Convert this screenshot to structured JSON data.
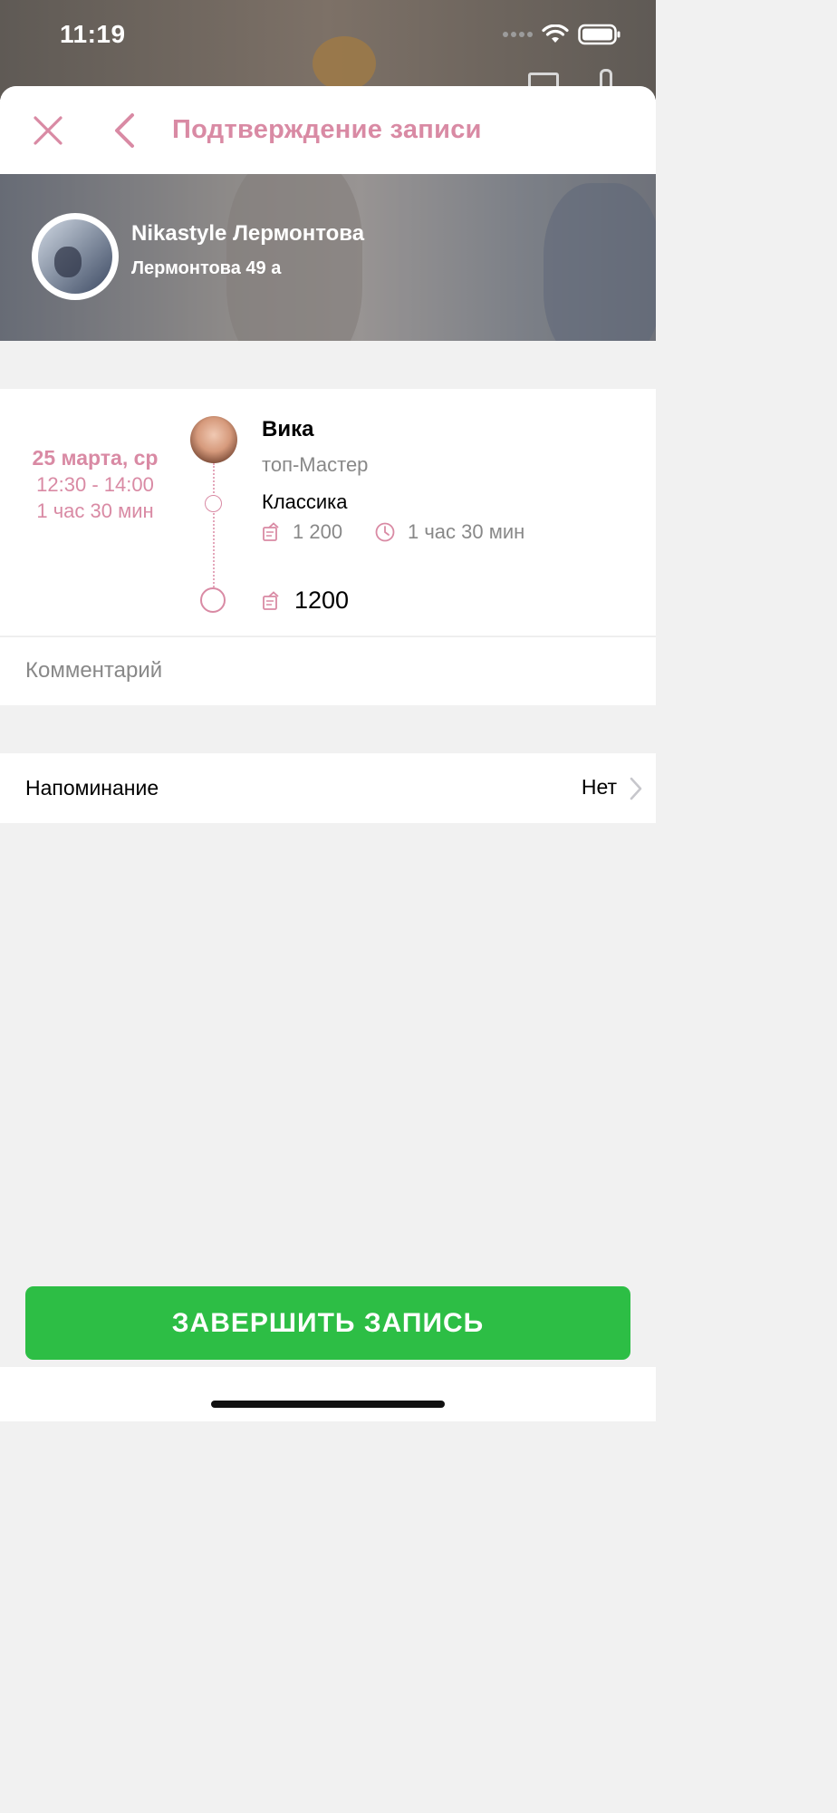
{
  "status_bar": {
    "time": "11:19"
  },
  "header": {
    "title": "Подтверждение записи"
  },
  "salon": {
    "name": "Nikastyle Лермонтова",
    "address": "Лермонтова 49 а"
  },
  "appointment": {
    "date": "25 марта, ср",
    "time_range": "12:30 - 14:00",
    "duration": "1 час 30 мин",
    "master": {
      "name": "Вика",
      "role": "топ-Мастер"
    },
    "service": {
      "name": "Классика",
      "price": "1 200",
      "duration": "1 час 30 мин"
    },
    "total": "1200"
  },
  "comment": {
    "placeholder": "Комментарий"
  },
  "reminder": {
    "label": "Напоминание",
    "value": "Нет"
  },
  "footer": {
    "button_label": "ЗАВЕРШИТЬ ЗАПИСЬ"
  },
  "colors": {
    "accent": "#d98aa4",
    "button": "#2dbe45",
    "background": "#f1f1f1"
  }
}
